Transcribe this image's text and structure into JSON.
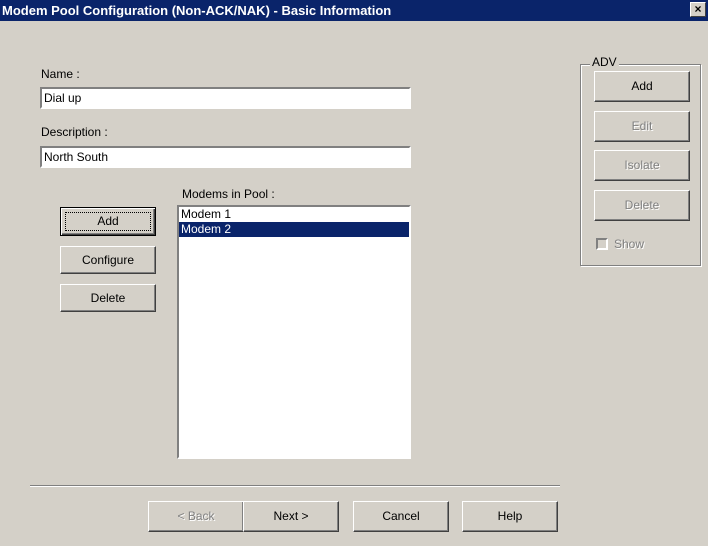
{
  "window": {
    "title": "Modem Pool Configuration (Non-ACK/NAK) - Basic Information",
    "close_glyph": "×"
  },
  "form": {
    "name_label": "Name :",
    "name_value": "Dial up",
    "description_label": "Description :",
    "description_value": "North South",
    "modems_label": "Modems in Pool :"
  },
  "modem_buttons": {
    "add": "Add",
    "configure": "Configure",
    "delete": "Delete"
  },
  "modems_list": [
    "Modem 1",
    "Modem 2"
  ],
  "selected_modem": "Modem 2",
  "adv": {
    "title": "ADV",
    "add": "Add",
    "edit": "Edit",
    "isolate": "Isolate",
    "delete": "Delete",
    "show": "Show",
    "show_checked": false
  },
  "footer": {
    "back": "< Back",
    "next": "Next >",
    "cancel": "Cancel",
    "help": "Help"
  },
  "colors": {
    "titlebar": "#0a246a",
    "face": "#d4d0c8",
    "selection": "#0a246a"
  }
}
